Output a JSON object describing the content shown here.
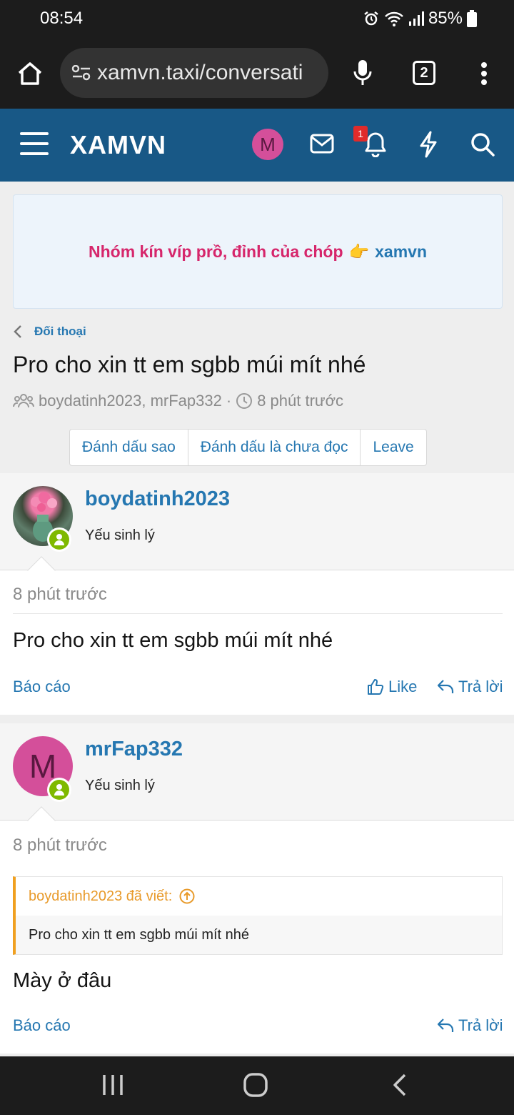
{
  "status_bar": {
    "time": "08:54",
    "battery": "85%"
  },
  "browser": {
    "url": "xamvn.taxi/conversati",
    "tab_count": "2"
  },
  "header": {
    "logo": "XAMVN",
    "avatar_letter": "M",
    "notification_count": "1"
  },
  "banner": {
    "text_pink": "Nhóm kín víp prồ, đỉnh của chóp",
    "emoji": "👉",
    "text_blue": "xamvn"
  },
  "breadcrumb": {
    "label": "Đối thoại"
  },
  "conversation": {
    "title": "Pro cho xin tt em sgbb múi mít nhé",
    "participants": "boydatinh2023, mrFap332",
    "separator": "·",
    "time": "8 phút trước"
  },
  "buttons": {
    "star": "Đánh dấu sao",
    "mark_unread": "Đánh dấu là chưa đọc",
    "leave": "Leave"
  },
  "messages": [
    {
      "username": "boydatinh2023",
      "user_title": "Yếu sinh lý",
      "time": "8 phút trước",
      "body": "Pro cho xin tt em sgbb múi mít nhé",
      "report": "Báo cáo",
      "like": "Like",
      "reply": "Trả lời"
    },
    {
      "username": "mrFap332",
      "avatar_letter": "M",
      "user_title": "Yếu sinh lý",
      "time": "8 phút trước",
      "quote_author": "boydatinh2023 đã viết:",
      "quote_body": "Pro cho xin tt em sgbb múi mít nhé",
      "body": "Mày ở đâu",
      "report": "Báo cáo",
      "reply": "Trả lời"
    }
  ],
  "colors": {
    "header_bg": "#185886",
    "link": "#2577b1",
    "accent_pink": "#d6266b",
    "online": "#7fb900",
    "quote_border": "#f0a020"
  }
}
